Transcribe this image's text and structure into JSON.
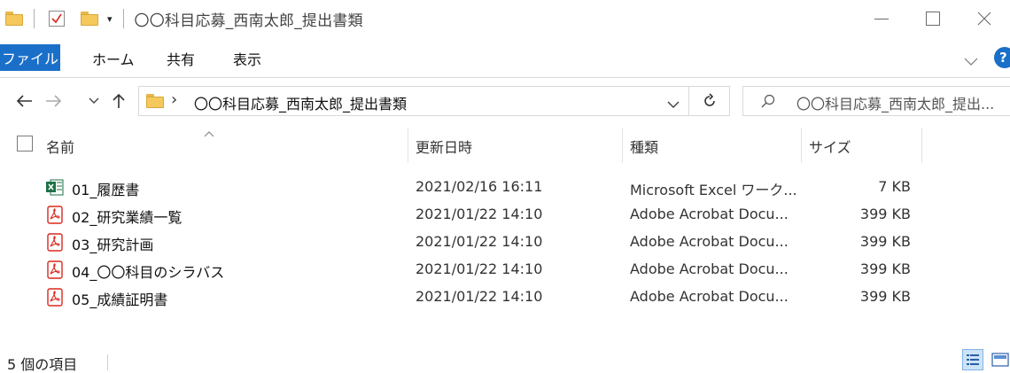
{
  "window": {
    "title": "〇〇科目応募_西南太郎_提出書類"
  },
  "ribbon": {
    "tabs": [
      "ファイル",
      "ホーム",
      "共有",
      "表示"
    ],
    "help_label": "?"
  },
  "address": {
    "path": "〇〇科目応募_西南太郎_提出書類",
    "chevron": "›"
  },
  "search": {
    "placeholder": "〇〇科目応募_西南太郎_提出..."
  },
  "columns": {
    "name": "名前",
    "modified": "更新日時",
    "type": "種類",
    "size": "サイズ"
  },
  "files": [
    {
      "name": "01_履歴書",
      "modified": "2021/02/16 16:11",
      "type": "Microsoft Excel ワーク...",
      "size": "7 KB",
      "icon": "excel-icon"
    },
    {
      "name": "02_研究業績一覧",
      "modified": "2021/01/22 14:10",
      "type": "Adobe Acrobat Docu...",
      "size": "399 KB",
      "icon": "pdf-icon"
    },
    {
      "name": "03_研究計画",
      "modified": "2021/01/22 14:10",
      "type": "Adobe Acrobat Docu...",
      "size": "399 KB",
      "icon": "pdf-icon"
    },
    {
      "name": "04_〇〇科目のシラバス",
      "modified": "2021/01/22 14:10",
      "type": "Adobe Acrobat Docu...",
      "size": "399 KB",
      "icon": "pdf-icon"
    },
    {
      "name": "05_成績証明書",
      "modified": "2021/01/22 14:10",
      "type": "Adobe Acrobat Docu...",
      "size": "399 KB",
      "icon": "pdf-icon"
    }
  ],
  "status": {
    "item_count": "5 個の項目"
  },
  "colors": {
    "accent": "#1a6fc9",
    "folder": "#f5c85c",
    "pdf_red": "#d9281e",
    "excel_green": "#1e7145"
  }
}
